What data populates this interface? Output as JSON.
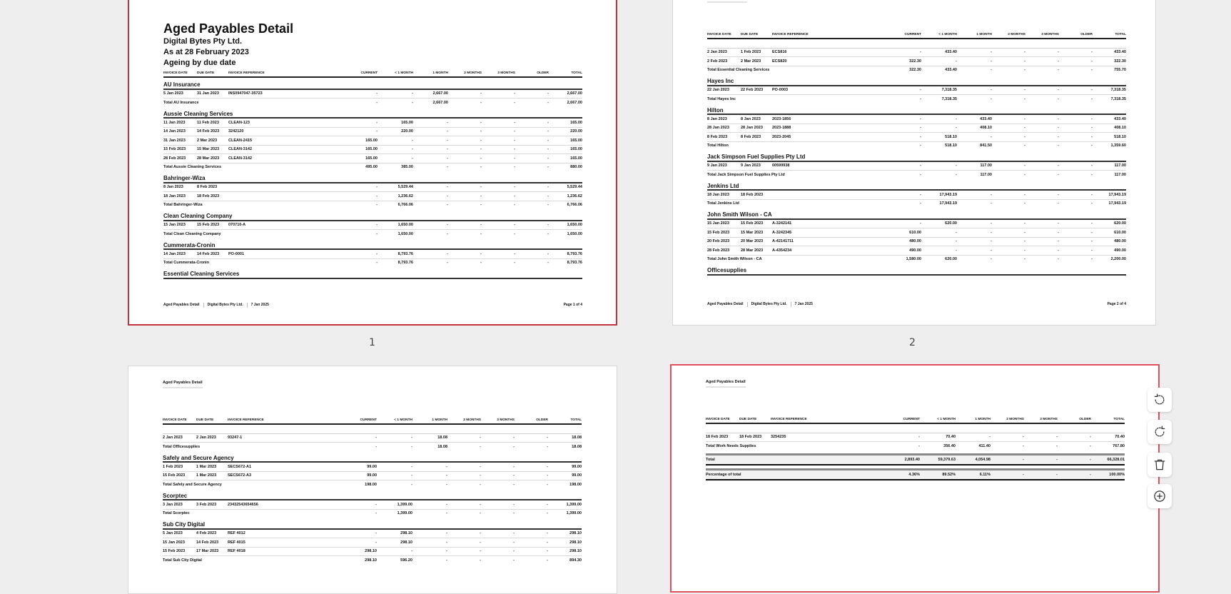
{
  "columns": [
    "INVOICE DATE",
    "DUE DATE",
    "INVOICE REFERENCE",
    "CURRENT",
    "< 1 MONTH",
    "1 MONTH",
    "2 MONTHS",
    "3 MONTHS",
    "OLDER",
    "TOTAL"
  ],
  "pages": [
    {
      "id": "p1",
      "label": "1",
      "title": "Aged Payables Detail",
      "subtitles": [
        "Digital Bytes Pty Ltd.",
        "As at 28 February 2023",
        "Ageing by due date"
      ],
      "footer": {
        "report": "Aged Payables Detail",
        "company": "Digital Bytes Pty Ltd.",
        "date": "7 Jan 2025",
        "page": "Page 1 of 4"
      },
      "rows": [
        {
          "type": "group",
          "name": "AU Insurance"
        },
        {
          "type": "row",
          "cells": [
            "5 Jan 2023",
            "31 Jan 2023",
            "INS0947047-35723",
            "-",
            "-",
            "2,667.00",
            "-",
            "-",
            "-",
            "2,667.00"
          ]
        },
        {
          "type": "total",
          "cells": [
            "Total AU Insurance",
            "",
            "",
            "-",
            "-",
            "2,667.00",
            "-",
            "-",
            "-",
            "2,667.00"
          ]
        },
        {
          "type": "group",
          "name": "Aussie Cleaning Services"
        },
        {
          "type": "row",
          "cells": [
            "11 Jan 2023",
            "11 Feb 2023",
            "CLEAN-123",
            "-",
            "165.00",
            "-",
            "-",
            "-",
            "-",
            "165.00"
          ]
        },
        {
          "type": "row",
          "cells": [
            "14 Jan 2023",
            "14 Feb 2023",
            "3242120",
            "-",
            "220.00",
            "-",
            "-",
            "-",
            "-",
            "220.00"
          ]
        },
        {
          "type": "row",
          "cells": [
            "31 Jan 2023",
            "2 Mar 2023",
            "CLEAN-2415",
            "165.00",
            "-",
            "-",
            "-",
            "-",
            "-",
            "165.00"
          ]
        },
        {
          "type": "row",
          "cells": [
            "15 Feb 2023",
            "15 Mar 2023",
            "CLEAN-3142",
            "165.00",
            "-",
            "-",
            "-",
            "-",
            "-",
            "165.00"
          ]
        },
        {
          "type": "row",
          "cells": [
            "28 Feb 2023",
            "28 Mar 2023",
            "CLEAN-3142",
            "165.00",
            "-",
            "-",
            "-",
            "-",
            "-",
            "165.00"
          ]
        },
        {
          "type": "total",
          "cells": [
            "Total Aussie Cleaning Services",
            "",
            "",
            "495.00",
            "385.00",
            "-",
            "-",
            "-",
            "-",
            "880.00"
          ]
        },
        {
          "type": "group",
          "name": "Bahringer-Wiza"
        },
        {
          "type": "row",
          "cells": [
            "8 Jan 2023",
            "8 Feb 2023",
            "",
            "-",
            "5,529.44",
            "-",
            "-",
            "-",
            "-",
            "5,529.44"
          ]
        },
        {
          "type": "row",
          "cells": [
            "18 Jan 2023",
            "18 Feb 2023",
            "",
            "-",
            "1,236.62",
            "-",
            "-",
            "-",
            "-",
            "1,236.62"
          ]
        },
        {
          "type": "total",
          "cells": [
            "Total Bahringer-Wiza",
            "",
            "",
            "-",
            "6,766.06",
            "-",
            "-",
            "-",
            "-",
            "6,766.06"
          ]
        },
        {
          "type": "group",
          "name": "Clean Cleaning Company"
        },
        {
          "type": "row",
          "cells": [
            "15 Jan 2023",
            "15 Feb 2023",
            "070710-A",
            "-",
            "1,650.00",
            "-",
            "-",
            "-",
            "-",
            "1,650.00"
          ]
        },
        {
          "type": "total",
          "cells": [
            "Total Clean Cleaning Company",
            "",
            "",
            "-",
            "1,650.00",
            "-",
            "-",
            "-",
            "-",
            "1,650.00"
          ]
        },
        {
          "type": "group",
          "name": "Cummerata-Cronin"
        },
        {
          "type": "row",
          "cells": [
            "14 Jan 2023",
            "14 Feb 2023",
            "PO-0001",
            "-",
            "8,793.76",
            "-",
            "-",
            "-",
            "-",
            "8,793.76"
          ]
        },
        {
          "type": "total",
          "cells": [
            "Total Cummerata-Cronin",
            "",
            "",
            "-",
            "8,793.76",
            "-",
            "-",
            "-",
            "-",
            "8,793.76"
          ]
        },
        {
          "type": "group",
          "name": "Essential Cleaning Services"
        }
      ]
    },
    {
      "id": "p2",
      "label": "2",
      "running_header": "Aged Payables Detail",
      "footer": {
        "report": "Aged Payables Detail",
        "company": "Digital Bytes Pty Ltd.",
        "date": "7 Jan 2025",
        "page": "Page 2 of 4"
      },
      "rows": [
        {
          "type": "blank"
        },
        {
          "type": "row",
          "cells": [
            "2 Jan 2023",
            "1 Feb 2023",
            "ECS816",
            "-",
            "433.40",
            "-",
            "-",
            "-",
            "-",
            "433.40"
          ]
        },
        {
          "type": "row",
          "cells": [
            "2 Feb 2023",
            "2 Mar 2023",
            "ECS820",
            "322.30",
            "-",
            "-",
            "-",
            "-",
            "-",
            "322.30"
          ]
        },
        {
          "type": "total",
          "cells": [
            "Total Essential Cleaning Services",
            "",
            "",
            "322.30",
            "433.40",
            "-",
            "-",
            "-",
            "-",
            "755.70"
          ]
        },
        {
          "type": "group",
          "name": "Hayes Inc"
        },
        {
          "type": "row",
          "cells": [
            "22 Jan 2023",
            "22 Feb 2023",
            "PO-0003",
            "-",
            "7,318.35",
            "-",
            "-",
            "-",
            "-",
            "7,318.35"
          ]
        },
        {
          "type": "total",
          "cells": [
            "Total Hayes Inc",
            "",
            "",
            "-",
            "7,318.35",
            "-",
            "-",
            "-",
            "-",
            "7,318.35"
          ]
        },
        {
          "type": "group",
          "name": "Hilton"
        },
        {
          "type": "row",
          "cells": [
            "8 Jan 2023",
            "8 Jan 2023",
            "2023-1856",
            "-",
            "-",
            "433.40",
            "-",
            "-",
            "-",
            "433.40"
          ]
        },
        {
          "type": "row",
          "cells": [
            "28 Jan 2023",
            "28 Jan 2023",
            "2023-1888",
            "-",
            "-",
            "408.10",
            "-",
            "-",
            "-",
            "408.10"
          ]
        },
        {
          "type": "row",
          "cells": [
            "8 Feb 2023",
            "8 Feb 2023",
            "2023-2045",
            "-",
            "518.10",
            "-",
            "-",
            "-",
            "-",
            "518.10"
          ]
        },
        {
          "type": "total",
          "cells": [
            "Total Hilton",
            "",
            "",
            "-",
            "518.10",
            "841.50",
            "-",
            "-",
            "-",
            "1,359.60"
          ]
        },
        {
          "type": "group",
          "name": "Jack Simpson Fuel Supplies Pty Ltd"
        },
        {
          "type": "row",
          "cells": [
            "9 Jan 2023",
            "9 Jan 2023",
            "00599938",
            "-",
            "-",
            "117.00",
            "-",
            "-",
            "-",
            "117.00"
          ]
        },
        {
          "type": "total",
          "cells": [
            "Total Jack Simpson Fuel Supplies Pty Ltd",
            "",
            "",
            "-",
            "-",
            "117.00",
            "-",
            "-",
            "-",
            "117.00"
          ]
        },
        {
          "type": "group",
          "name": "Jenkins Ltd"
        },
        {
          "type": "row",
          "cells": [
            "18 Jan 2023",
            "18 Feb 2023",
            "",
            "-",
            "17,943.19",
            "-",
            "-",
            "-",
            "-",
            "17,943.19"
          ]
        },
        {
          "type": "total",
          "cells": [
            "Total Jenkins Ltd",
            "",
            "",
            "-",
            "17,943.19",
            "-",
            "-",
            "-",
            "-",
            "17,943.19"
          ]
        },
        {
          "type": "group",
          "name": "John Smith Wilson - CA"
        },
        {
          "type": "row",
          "cells": [
            "15 Jan 2023",
            "15 Feb 2023",
            "A-3242141",
            "-",
            "620.00",
            "-",
            "-",
            "-",
            "-",
            "620.00"
          ]
        },
        {
          "type": "row",
          "cells": [
            "15 Feb 2023",
            "15 Mar 2023",
            "A-3242345",
            "610.00",
            "-",
            "-",
            "-",
            "-",
            "-",
            "610.00"
          ]
        },
        {
          "type": "row",
          "cells": [
            "20 Feb 2023",
            "20 Mar 2023",
            "A-42141711",
            "480.00",
            "-",
            "-",
            "-",
            "-",
            "-",
            "480.00"
          ]
        },
        {
          "type": "row",
          "cells": [
            "28 Feb 2023",
            "28 Mar 2023",
            "A-4354234",
            "490.00",
            "-",
            "-",
            "-",
            "-",
            "-",
            "490.00"
          ]
        },
        {
          "type": "total",
          "cells": [
            "Total John Smith Wilson - CA",
            "",
            "",
            "1,580.00",
            "620.00",
            "-",
            "-",
            "-",
            "-",
            "2,200.00"
          ]
        },
        {
          "type": "group",
          "name": "Officesupplies"
        }
      ]
    },
    {
      "id": "p3",
      "running_header": "Aged Payables Detail",
      "rows": [
        {
          "type": "blank"
        },
        {
          "type": "row",
          "cells": [
            "2 Jan 2023",
            "2 Jan 2023",
            "93247-1",
            "-",
            "-",
            "18.08",
            "-",
            "-",
            "-",
            "18.08"
          ]
        },
        {
          "type": "total",
          "cells": [
            "Total Officesupplies",
            "",
            "",
            "-",
            "-",
            "18.08",
            "-",
            "-",
            "-",
            "18.08"
          ]
        },
        {
          "type": "group",
          "name": "Safely and Secure Agency"
        },
        {
          "type": "row",
          "cells": [
            "1 Feb 2023",
            "1 Mar 2023",
            "SECS672-A1",
            "99.00",
            "-",
            "-",
            "-",
            "-",
            "-",
            "99.00"
          ]
        },
        {
          "type": "row",
          "cells": [
            "15 Feb 2023",
            "1 Mar 2023",
            "SECS672-A3",
            "99.00",
            "-",
            "-",
            "-",
            "-",
            "-",
            "99.00"
          ]
        },
        {
          "type": "total",
          "cells": [
            "Total Safely and Secure Agency",
            "",
            "",
            "198.00",
            "-",
            "-",
            "-",
            "-",
            "-",
            "198.00"
          ]
        },
        {
          "type": "group",
          "name": "Scorptec"
        },
        {
          "type": "row",
          "cells": [
            "3 Jan 2023",
            "3 Feb 2023",
            "23432543654656",
            "-",
            "1,399.00",
            "-",
            "-",
            "-",
            "-",
            "1,399.00"
          ]
        },
        {
          "type": "total",
          "cells": [
            "Total Scorptec",
            "",
            "",
            "-",
            "1,399.00",
            "-",
            "-",
            "-",
            "-",
            "1,399.00"
          ]
        },
        {
          "type": "group",
          "name": "Sub City Digital"
        },
        {
          "type": "row",
          "cells": [
            "5 Jan 2023",
            "4 Feb 2023",
            "REF 4012",
            "-",
            "298.10",
            "-",
            "-",
            "-",
            "-",
            "298.10"
          ]
        },
        {
          "type": "row",
          "cells": [
            "15 Jan 2023",
            "14 Feb 2023",
            "REF 4015",
            "-",
            "298.10",
            "-",
            "-",
            "-",
            "-",
            "298.10"
          ]
        },
        {
          "type": "row",
          "cells": [
            "15 Feb 2023",
            "17 Mar 2023",
            "REF 4018",
            "298.10",
            "-",
            "-",
            "-",
            "-",
            "-",
            "298.10"
          ]
        },
        {
          "type": "total",
          "cells": [
            "Total Sub City Digital",
            "",
            "",
            "298.10",
            "596.20",
            "-",
            "-",
            "-",
            "-",
            "894.30"
          ]
        }
      ]
    },
    {
      "id": "p4",
      "running_header": "Aged Payables Detail",
      "rows": [
        {
          "type": "blank"
        },
        {
          "type": "row",
          "cells": [
            "18 Feb 2023",
            "18 Feb 2023",
            "3254235",
            "-",
            "70.40",
            "-",
            "-",
            "-",
            "-",
            "70.40"
          ]
        },
        {
          "type": "total",
          "cells": [
            "Total Work Needs Supplies",
            "",
            "",
            "-",
            "356.40",
            "411.40",
            "-",
            "-",
            "-",
            "767.80"
          ]
        },
        {
          "type": "grand",
          "cells": [
            "Total",
            "",
            "",
            "2,893.40",
            "59,379.63",
            "4,054.98",
            "-",
            "-",
            "-",
            "66,328.01"
          ]
        },
        {
          "type": "grand",
          "cells": [
            "Percentage of total",
            "",
            "",
            "4.36%",
            "89.52%",
            "6.11%",
            "-",
            "-",
            "-",
            "100.00%"
          ]
        }
      ]
    }
  ],
  "toolbar": [
    {
      "icon": "rotate-left-icon",
      "action": "rotate-left"
    },
    {
      "icon": "rotate-right-icon",
      "action": "rotate-right"
    },
    {
      "icon": "trash-icon",
      "action": "delete-page"
    },
    {
      "icon": "plus-circle-icon",
      "action": "add-page"
    }
  ],
  "colors": {
    "selected_border": "#e0505e",
    "background": "#eeeeee"
  }
}
